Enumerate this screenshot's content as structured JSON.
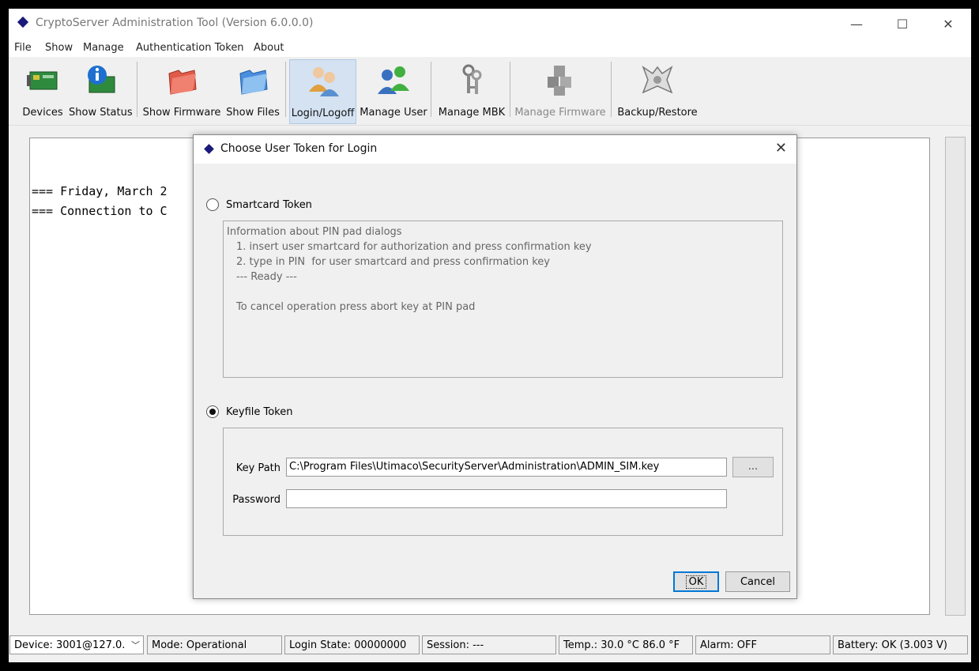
{
  "window": {
    "title": "CryptoServer Administration Tool (Version 6.0.0.0)",
    "minimize_glyph": "—",
    "maximize_glyph": "☐",
    "close_glyph": "✕"
  },
  "menu": [
    "File",
    "Show",
    "Manage",
    "Authentication Token",
    "About"
  ],
  "toolbar": {
    "items": [
      {
        "label": "Devices",
        "icon": "devices-icon"
      },
      {
        "label": "Show Status",
        "icon": "show-status-icon"
      },
      {
        "label": "Show Firmware",
        "icon": "red-folder-icon"
      },
      {
        "label": "Show Files",
        "icon": "blue-folder-icon"
      },
      {
        "label": "Login/Logoff",
        "icon": "users-icon"
      },
      {
        "label": "Manage User",
        "icon": "manage-user-icon"
      },
      {
        "label": "Manage MBK",
        "icon": "keys-icon"
      },
      {
        "label": "Manage Firmware",
        "icon": "cubes-icon"
      },
      {
        "label": "Backup/Restore",
        "icon": "backup-restore-icon"
      }
    ],
    "active": "Login/Logoff",
    "disabled": "Manage Firmware"
  },
  "console": {
    "lines": [
      "=== Friday, March 2",
      "=== Connection to C"
    ]
  },
  "dialog": {
    "title": "Choose User Token for Login",
    "close_glyph": "✕",
    "smartcard_label": "Smartcard Token",
    "smartcard_selected": false,
    "info_lines": [
      "Information about PIN pad dialogs",
      "1. insert user smartcard for authorization and press confirmation key",
      "2. type in PIN  for user smartcard and press confirmation key",
      "--- Ready ---",
      "To cancel operation press abort key at PIN pad"
    ],
    "keyfile_label": "Keyfile Token",
    "keyfile_selected": true,
    "key_path_label": "Key Path",
    "key_path_value": "C:\\Program Files\\Utimaco\\SecurityServer\\Administration\\ADMIN_SIM.key",
    "browse_label": "...",
    "password_label": "Password",
    "password_value": "",
    "ok_label": "OK",
    "cancel_label": "Cancel"
  },
  "status": {
    "device": "Device: 3001@127.0.",
    "mode": "Mode: Operational",
    "login_state": "Login State: 00000000",
    "session": "Session: ---",
    "temp": "Temp.: 30.0 °C   86.0 °F",
    "alarm": "Alarm: OFF",
    "battery": "Battery:  OK  (3.003 V)"
  }
}
